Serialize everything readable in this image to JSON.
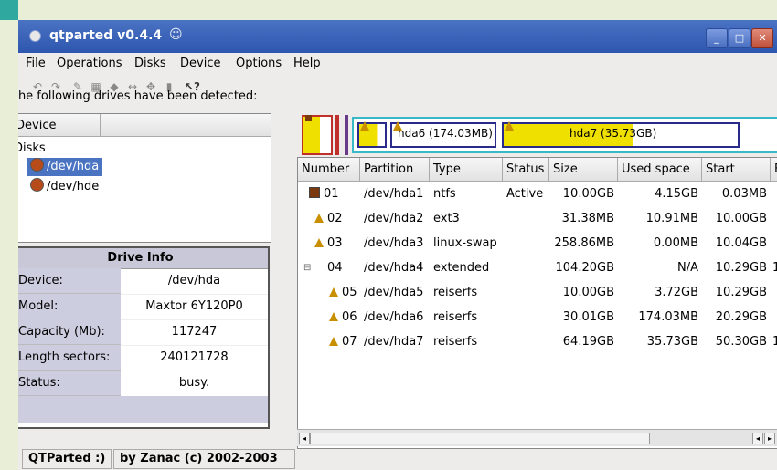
{
  "window": {
    "title": "qtparted v0.4.4"
  },
  "menus": [
    {
      "label": "File",
      "mnemonic": "F",
      "rest": "ile"
    },
    {
      "label": "Operations",
      "mnemonic": "O",
      "rest": "perations"
    },
    {
      "label": "Disks",
      "mnemonic": "D",
      "rest": "isks"
    },
    {
      "label": "Device",
      "mnemonic": "D",
      "rest": "evice"
    },
    {
      "label": "Options",
      "mnemonic": "O",
      "rest": "ptions"
    },
    {
      "label": "Help",
      "mnemonic": "H",
      "rest": "elp"
    }
  ],
  "toolbar_icons": [
    "undo-icon",
    "redo-icon",
    "wrench-icon",
    "property-icon",
    "delete-icon",
    "resize-icon",
    "move-icon",
    "trash-icon",
    "whats-this-icon"
  ],
  "left": {
    "drives_label": "The following drives have been detected:",
    "tree_header": "Device",
    "tree_root": "Disks",
    "drives": [
      "/dev/hda",
      "/dev/hde"
    ],
    "selected_drive": "/dev/hda"
  },
  "drive_info": {
    "title": "Drive Info",
    "rows": [
      {
        "key": "Device:",
        "value": "/dev/hda"
      },
      {
        "key": "Model:",
        "value": "Maxtor 6Y120P0"
      },
      {
        "key": "Capacity (Mb):",
        "value": "117247"
      },
      {
        "key": "Length sectors:",
        "value": "240121728"
      },
      {
        "key": "Status:",
        "value": "busy."
      }
    ]
  },
  "map_labels": {
    "hda6": "hda6 (174.03MB)",
    "hda7": "hda7 (35.73GB)"
  },
  "table": {
    "columns": [
      "Number",
      "Partition",
      "Type",
      "Status",
      "Size",
      "Used space",
      "Start",
      "E"
    ],
    "rows": [
      {
        "number": "01",
        "partition": "/dev/hda1",
        "type": "ntfs",
        "status": "Active",
        "size": "10.00GB",
        "used": "4.15GB",
        "start": "0.03MB",
        "end": ""
      },
      {
        "number": "02",
        "partition": "/dev/hda2",
        "type": "ext3",
        "status": "",
        "size": "31.38MB",
        "used": "10.91MB",
        "start": "10.00GB",
        "end": ""
      },
      {
        "number": "03",
        "partition": "/dev/hda3",
        "type": "linux-swap",
        "status": "",
        "size": "258.86MB",
        "used": "0.00MB",
        "start": "10.04GB",
        "end": ""
      },
      {
        "number": "04",
        "partition": "/dev/hda4",
        "type": "extended",
        "status": "",
        "size": "104.20GB",
        "used": "N/A",
        "start": "10.29GB",
        "end": "1"
      },
      {
        "number": "05",
        "partition": "/dev/hda5",
        "type": "reiserfs",
        "status": "",
        "size": "10.00GB",
        "used": "3.72GB",
        "start": "10.29GB",
        "end": ""
      },
      {
        "number": "06",
        "partition": "/dev/hda6",
        "type": "reiserfs",
        "status": "",
        "size": "30.01GB",
        "used": "174.03MB",
        "start": "20.29GB",
        "end": ""
      },
      {
        "number": "07",
        "partition": "/dev/hda7",
        "type": "reiserfs",
        "status": "",
        "size": "64.19GB",
        "used": "35.73GB",
        "start": "50.30GB",
        "end": "1"
      }
    ]
  },
  "statusbar": {
    "left": "QTParted :)",
    "right": "by Zanac (c) 2002-2003"
  },
  "colors": {
    "titlebar": "#3a63b8",
    "selection": "#4a74c2",
    "ntfs": "#7a3a0e",
    "used_fill": "#f0e000",
    "extended_border": "#39b8c8"
  }
}
